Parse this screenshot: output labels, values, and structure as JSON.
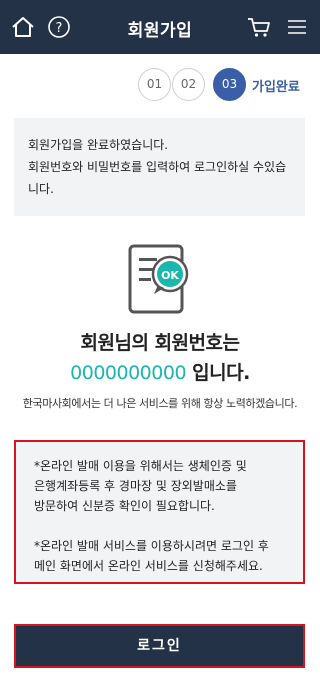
{
  "header": {
    "title": "회원가입",
    "icons": {
      "home": "home-icon",
      "help": "help-icon",
      "cart": "cart-icon",
      "menu": "menu-icon"
    },
    "bg_color": "#243247"
  },
  "steps": {
    "items": [
      "01",
      "02",
      "03"
    ],
    "active_index": 2,
    "current_label": "가입완료"
  },
  "message": {
    "line1": "회원가입을 완료하였습니다.",
    "line2": "회원번호와 비밀번호를 입력하여 로그인하실 수있습",
    "line3": "니다."
  },
  "badge": {
    "icon": "ok-document-icon",
    "text": "OK",
    "color": "#19b7ac"
  },
  "result": {
    "line1": "회원님의 회원번호는",
    "member_number": "0000000000",
    "suffix": "입니다."
  },
  "info_text": "한국마사회에서는 더 나은 서비스를 위해 항상 노력하겠습니다.",
  "notice": {
    "p1_l1": "*온라인 발매 이용을 위해서는 생체인증 및",
    "p1_l2": "은행계좌등록 후 경마장 및 장외발매소를",
    "p1_l3": "방문하여 신분증 확인이 필요합니다.",
    "p2_l1": "*온라인 발매 서비스를 이용하시려면 로그인 후",
    "p2_l2": "메인 화면에서 온라인 서비스를 신청해주세요."
  },
  "login_button": "로그인",
  "colors": {
    "accent": "#3a5fa8",
    "teal": "#19b7ac",
    "highlight_border": "#d9121c"
  }
}
